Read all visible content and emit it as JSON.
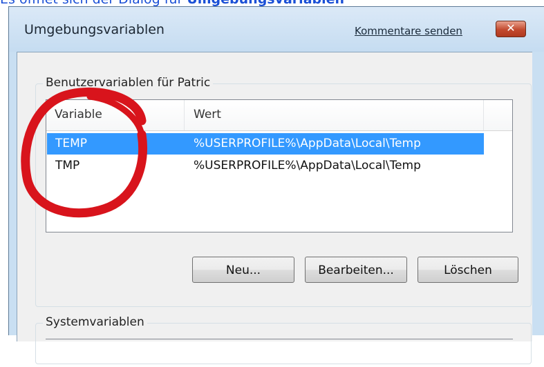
{
  "caption": {
    "prefix": "Es öffnet sich der Dialog für ",
    "bold": "Umgebungsvariablen"
  },
  "window": {
    "title": "Umgebungsvariablen",
    "feedback_link": "Kommentare senden",
    "close_label": "✕"
  },
  "user_vars": {
    "group_label": "Benutzervariablen für Patric",
    "columns": {
      "variable": "Variable",
      "value": "Wert"
    },
    "rows": [
      {
        "variable": "TEMP",
        "value": "%USERPROFILE%\\AppData\\Local\\Temp",
        "selected": true
      },
      {
        "variable": "TMP",
        "value": "%USERPROFILE%\\AppData\\Local\\Temp",
        "selected": false
      }
    ],
    "buttons": {
      "new": "Neu...",
      "edit": "Bearbeiten...",
      "delete": "Löschen"
    }
  },
  "system_vars": {
    "group_label": "Systemvariablen"
  },
  "colors": {
    "selection": "#3399ff",
    "annotation_circle": "#d8141c",
    "caption_text": "#1a4fd6"
  }
}
